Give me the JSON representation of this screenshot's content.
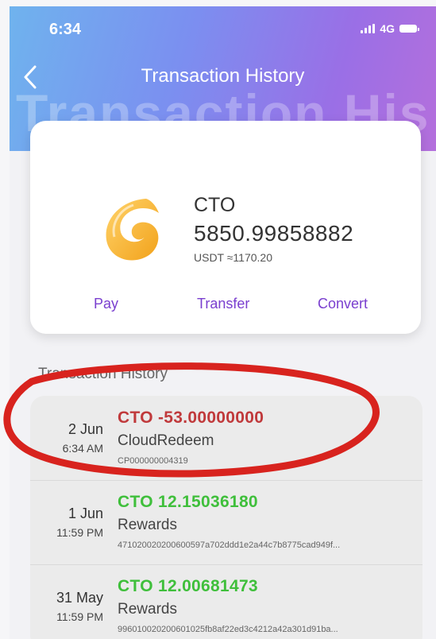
{
  "status": {
    "time": "6:34",
    "network": "4G"
  },
  "nav": {
    "title": "Transaction History",
    "ghost_title": "Transaction His"
  },
  "wallet": {
    "coin": "CTO",
    "balance": "5850.99858882",
    "usdt_value": "USDT ≈1170.20",
    "actions": {
      "pay": "Pay",
      "transfer": "Transfer",
      "convert": "Convert"
    }
  },
  "history": {
    "label": "Transaction History",
    "items": [
      {
        "date": "2 Jun",
        "time": "6:34 AM",
        "amount": "CTO -53.00000000",
        "type": "CloudRedeem",
        "ref": "CP000000004319",
        "direction": "out"
      },
      {
        "date": "1 Jun",
        "time": "11:59 PM",
        "amount": "CTO 12.15036180",
        "type": "Rewards",
        "ref": "471020020200600597a702ddd1e2a44c7b8775cad949f...",
        "direction": "in"
      },
      {
        "date": "31 May",
        "time": "11:59 PM",
        "amount": "CTO 12.00681473",
        "type": "Rewards",
        "ref": "996010020200601025fb8af22ed3c4212a42a301d91ba...",
        "direction": "in"
      }
    ]
  },
  "colors": {
    "negative": "#c0393b",
    "positive": "#3fbf3b",
    "accent": "#7a3fcf",
    "highlight_oval": "#d8231e"
  }
}
